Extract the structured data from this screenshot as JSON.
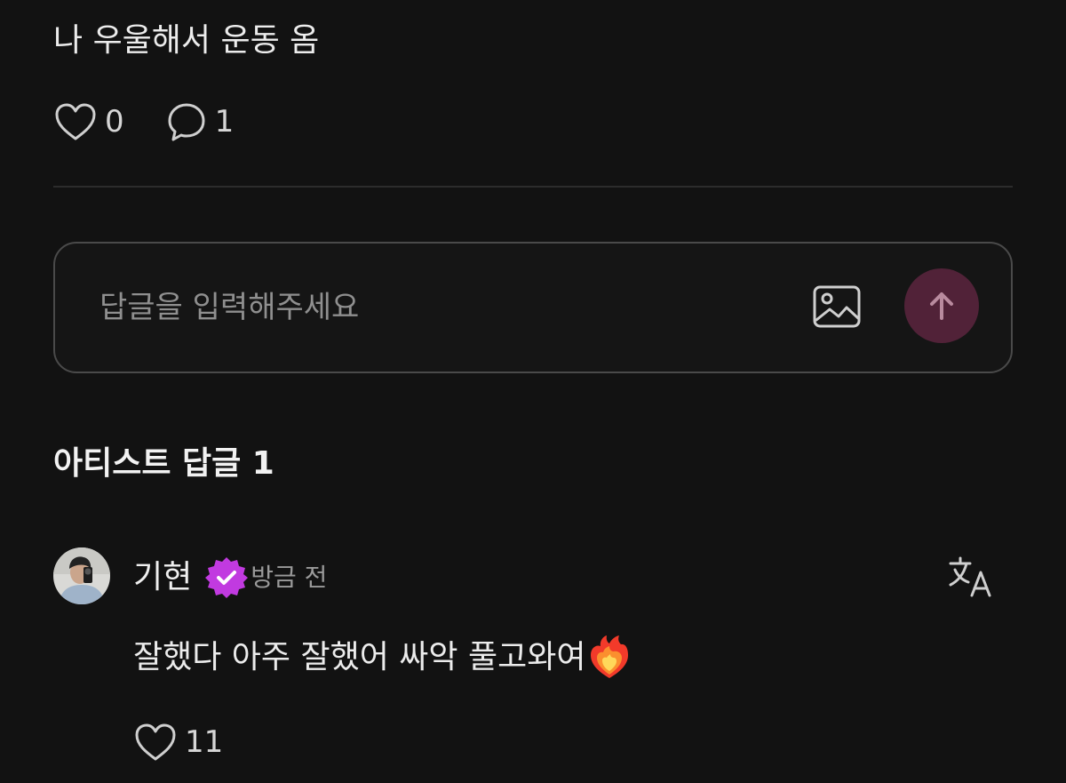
{
  "post": {
    "text": "나 우울해서 운동 옴",
    "likes": "0",
    "comments": "1"
  },
  "reply": {
    "placeholder": "답글을 입력해주세요"
  },
  "artist_replies": {
    "title": "아티스트 답글 1"
  },
  "comment": {
    "author": "기현",
    "timestamp": "방금 전",
    "text": "잘했다 아주 잘했어 싸악 풀고와여",
    "emoji_icon": "heart-on-fire-emoji",
    "likes": "11"
  },
  "colors": {
    "background": "#121212",
    "send_button": "#512238",
    "verified_badge": "#c13ae0"
  }
}
